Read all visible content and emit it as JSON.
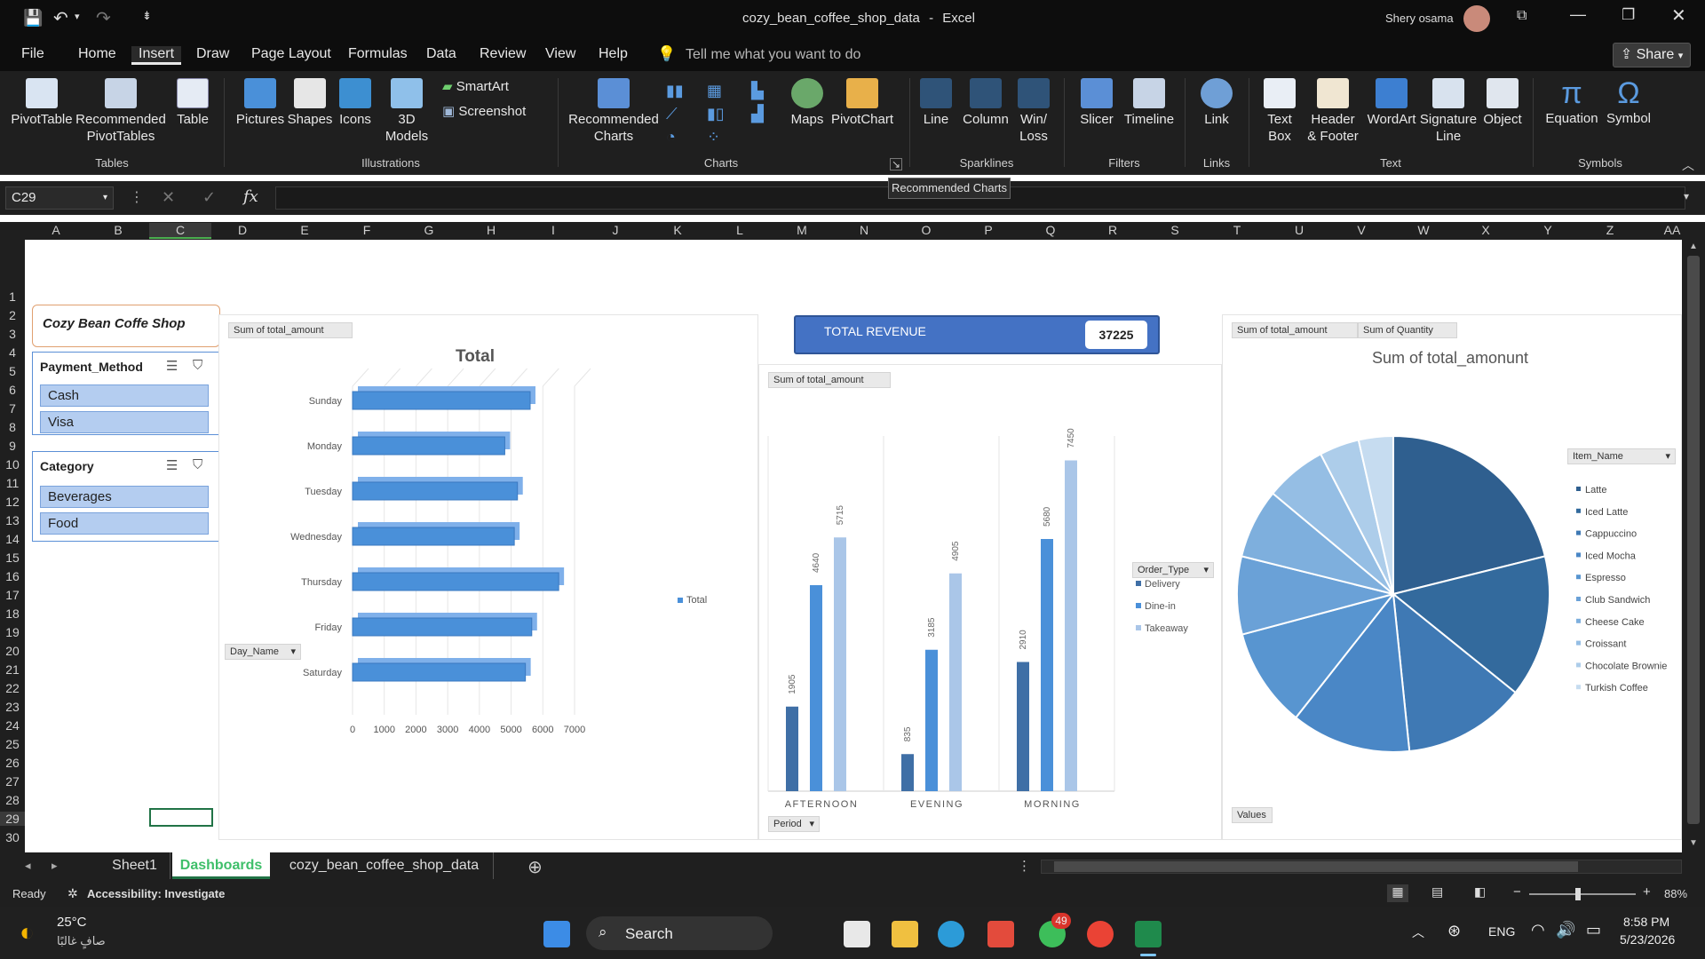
{
  "window": {
    "doc_title": "cozy_bean_coffee_shop_data",
    "app_name": "Excel",
    "separator": "-",
    "user": "Shery osama"
  },
  "menu": {
    "items": [
      "File",
      "Home",
      "Insert",
      "Draw",
      "Page Layout",
      "Formulas",
      "Data",
      "Review",
      "View",
      "Help"
    ],
    "active": "Insert",
    "tell_me": "Tell me what you want to do",
    "share": "Share"
  },
  "ribbon": {
    "pivottable": "PivotTable",
    "recommended_pivot": [
      "Recommended",
      "PivotTables"
    ],
    "table": "Table",
    "pictures": "Pictures",
    "shapes": "Shapes",
    "icons": "Icons",
    "models": [
      "3D",
      "Models"
    ],
    "smartart": "SmartArt",
    "screenshot": "Screenshot",
    "recommended_charts": [
      "Recommended",
      "Charts"
    ],
    "maps": "Maps",
    "pivotchart": "PivotChart",
    "line": "Line",
    "column": "Column",
    "winloss": [
      "Win/",
      "Loss"
    ],
    "slicer": "Slicer",
    "timeline": "Timeline",
    "link": "Link",
    "textbox": [
      "Text",
      "Box"
    ],
    "header_footer": [
      "Header",
      "& Footer"
    ],
    "wordart": "WordArt",
    "signature": [
      "Signature",
      "Line"
    ],
    "object": "Object",
    "equation": "Equation",
    "symbol": "Symbol",
    "groups": {
      "tables": "Tables",
      "illustrations": "Illustrations",
      "charts": "Charts",
      "sparklines": "Sparklines",
      "filters": "Filters",
      "links": "Links",
      "text": "Text",
      "symbols": "Symbols"
    },
    "tooltip": "Recommended Charts"
  },
  "formula": {
    "namebox": "C29",
    "fx": "fx",
    "cancel": "✕",
    "enter": "✓"
  },
  "columns": [
    "A",
    "B",
    "C",
    "D",
    "E",
    "F",
    "G",
    "H",
    "I",
    "J",
    "K",
    "L",
    "M",
    "N",
    "O",
    "P",
    "Q",
    "R",
    "S",
    "T",
    "U",
    "V",
    "W",
    "X",
    "Y",
    "Z",
    "AA"
  ],
  "rows": [
    "1",
    "2",
    "3",
    "4",
    "5",
    "6",
    "7",
    "8",
    "9",
    "10",
    "11",
    "12",
    "13",
    "14",
    "15",
    "16",
    "17",
    "18",
    "19",
    "20",
    "21",
    "22",
    "23",
    "24",
    "25",
    "26",
    "27",
    "28",
    "29",
    "30"
  ],
  "dashboard": {
    "title": "Cozy Bean Coffe Shop",
    "payment_slicer": {
      "header": "Payment_Method",
      "items": [
        "Cash",
        "Visa"
      ]
    },
    "category_slicer": {
      "header": "Category",
      "items": [
        "Beverages",
        "Food"
      ]
    },
    "kpi": {
      "label": "TOTAL REVENUE",
      "value": "37225"
    }
  },
  "charts": {
    "bar_day": {
      "field_value": "Sum of total_amount",
      "field_axis": "Day_Name",
      "legend": "Total"
    },
    "column_period": {
      "field_value": "Sum of total_amount",
      "field_axis": "Period",
      "legend_title": "Order_Type"
    },
    "pie_item": {
      "field_value1": "Sum of total_amount",
      "field_value2": "Sum of Quantity",
      "field_values": "Values",
      "legend_title": "Item_Name"
    }
  },
  "chart_data": [
    {
      "type": "bar",
      "title": "Total",
      "categories": [
        "Sunday",
        "Monday",
        "Tuesday",
        "Wednesday",
        "Thursday",
        "Friday",
        "Saturday"
      ],
      "values": [
        5600,
        4800,
        5200,
        5100,
        6500,
        5650,
        5450
      ],
      "xlim": [
        0,
        7000
      ],
      "xticks": [
        "0",
        "1000",
        "2000",
        "3000",
        "4000",
        "5000",
        "6000",
        "7000"
      ],
      "series": [
        {
          "name": "Total",
          "color": "#4a90d9"
        }
      ]
    },
    {
      "type": "bar",
      "title": "",
      "categories": [
        "AFTERNOON",
        "EVENING",
        "MORNING"
      ],
      "series": [
        {
          "name": "Delivery",
          "values": [
            1905,
            835,
            2910
          ],
          "labels": [
            "1905",
            "835",
            "2910"
          ],
          "color": "#3f6fa6"
        },
        {
          "name": "Dine-in",
          "values": [
            4640,
            3185,
            5680
          ],
          "labels": [
            "4640",
            "3185",
            "5680"
          ],
          "color": "#4a90d9"
        },
        {
          "name": "Takeaway",
          "values": [
            5715,
            4905,
            7450
          ],
          "labels": [
            "5715",
            "4905",
            "7450"
          ],
          "color": "#aac6e8"
        }
      ],
      "ylim": [
        0,
        8000
      ]
    },
    {
      "type": "pie",
      "title": "Sum of total_amonunt",
      "categories": [
        "Latte",
        "Iced Latte",
        "Cappuccino",
        "Iced Mocha",
        "Espresso",
        "Club Sandwich",
        "Cheese Cake",
        "Croissant",
        "Chocolate Brownie",
        "Turkish Coffee"
      ],
      "values": [
        7700,
        5300,
        4600,
        4500,
        3700,
        2900,
        2600,
        2300,
        1500,
        1300
      ],
      "colors": [
        "#2f5f8f",
        "#336a9d",
        "#3f79b4",
        "#4a87c6",
        "#5895d0",
        "#6aa1d7",
        "#7eafdd",
        "#95bee4",
        "#adcdea",
        "#c6dcf0"
      ]
    }
  ],
  "sheets": {
    "items": [
      "Sheet1",
      "Dashboards",
      "cozy_bean_coffee_shop_data"
    ],
    "active": "Dashboards"
  },
  "status": {
    "ready": "Ready",
    "accessibility": "Accessibility: Investigate",
    "zoom": "88%"
  },
  "taskbar": {
    "temp": "25°C",
    "weather": "صافٍ غالبًا",
    "search": "Search",
    "lang": "ENG",
    "time": "8:58 PM",
    "date": "5/23/2026",
    "badge": "49"
  }
}
